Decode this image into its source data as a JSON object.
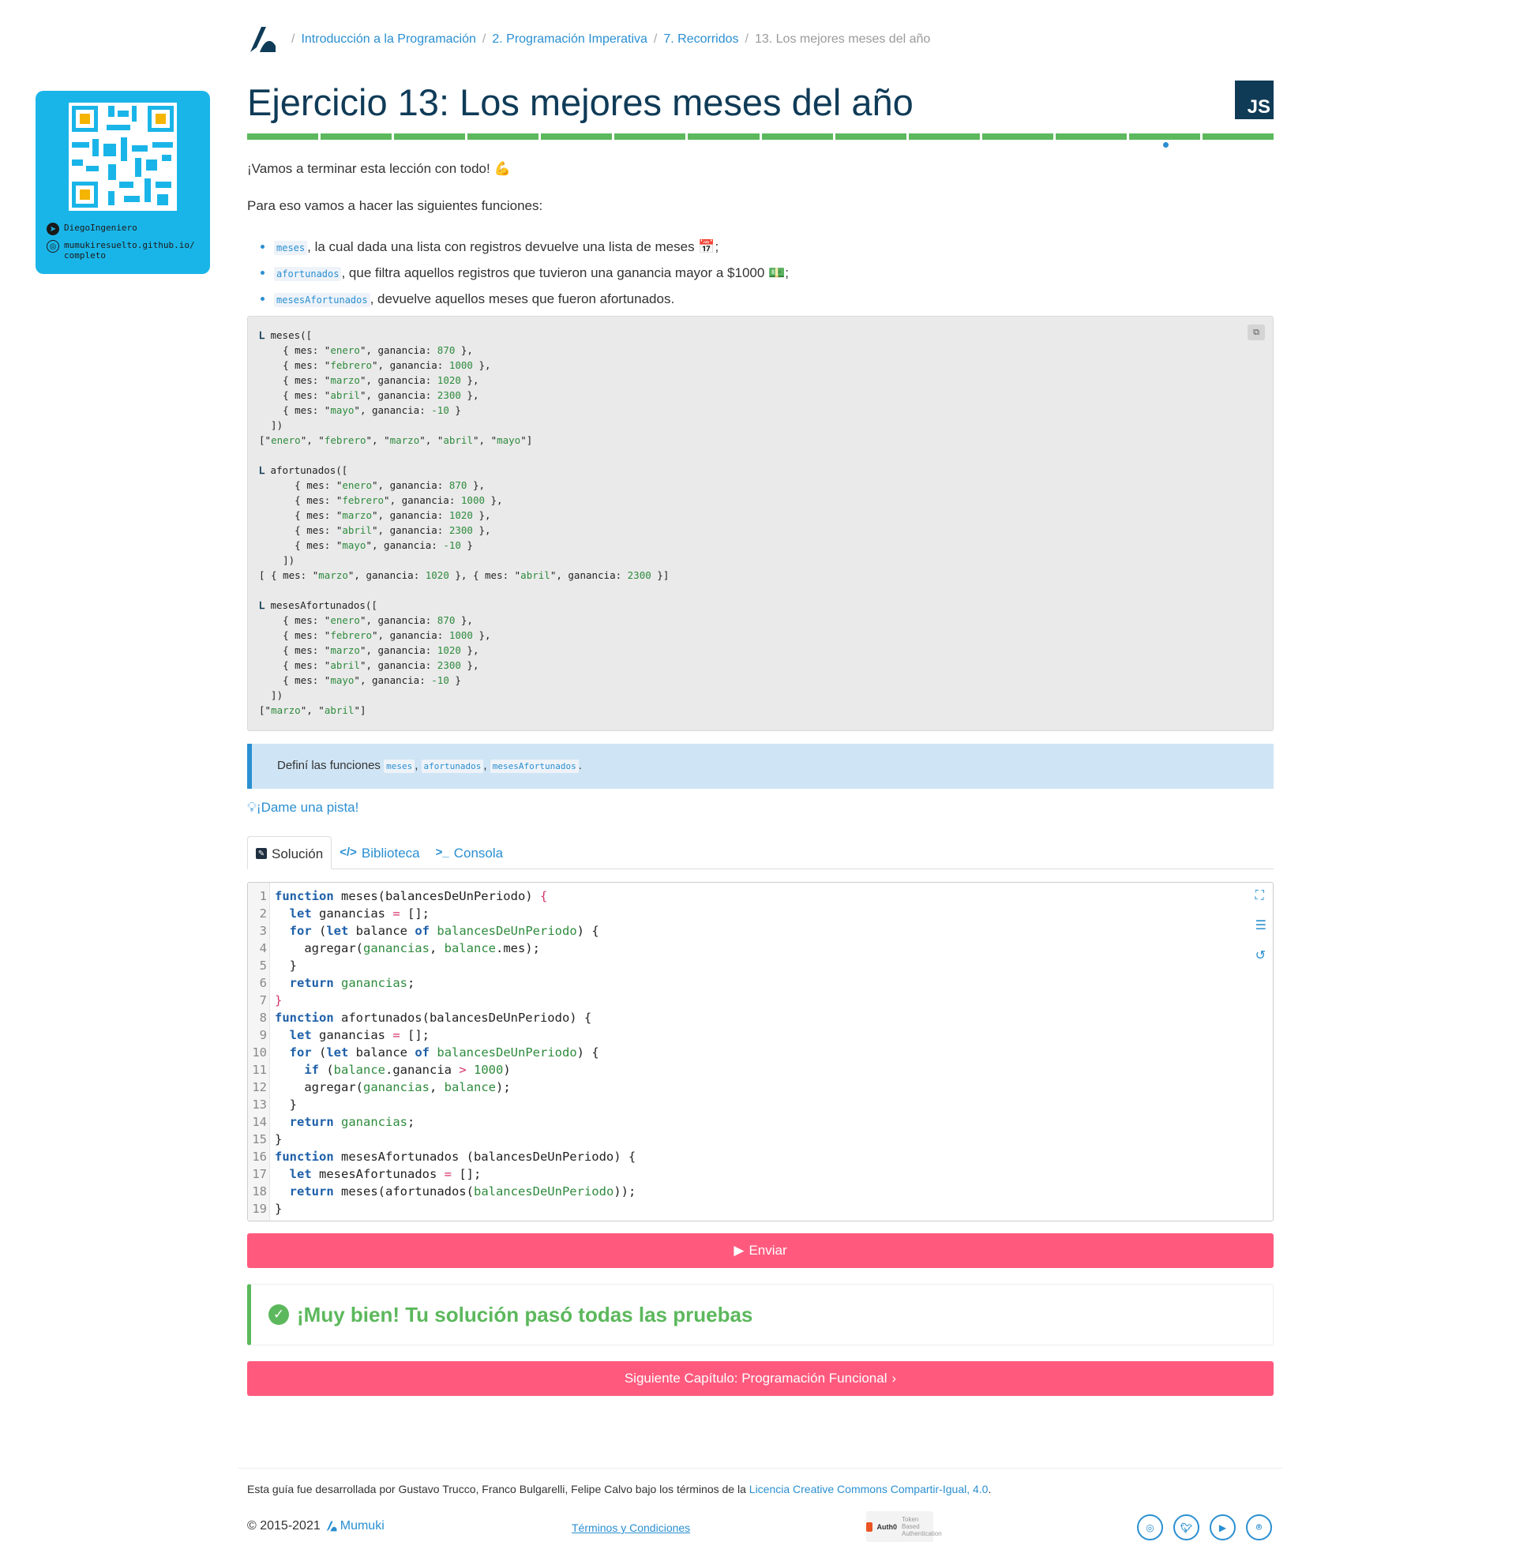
{
  "sidebar": {
    "telegram_user": "DiegoIngeniero",
    "website": "mumukiresuelto.github.io/completo",
    "website_line1": "mumukiresuelto.github.io/",
    "website_line2": "completo"
  },
  "breadcrumb": {
    "items": [
      "Introducción a la Programación",
      "2. Programación Imperativa",
      "7. Recorridos"
    ],
    "current": "13. Los mejores meses del año"
  },
  "exercise": {
    "title": "Ejercicio 13: Los mejores meses del año",
    "language_badge": "JS",
    "progress_segments": 14,
    "current_segment": 13,
    "intro": "¡Vamos a terminar esta lección con todo!",
    "intro_emoji": "💪",
    "intro2": "Para eso vamos a hacer las siguientes funciones:",
    "bullets": [
      {
        "code": "meses",
        "text": ", la cual dada una lista con registros devuelve una lista de meses",
        "emoji": "📅",
        "suffix": ";"
      },
      {
        "code": "afortunados",
        "text": ", que filtra aquellos registros que tuvieron una ganancia mayor a $1000",
        "emoji": "💵",
        "suffix": ";"
      },
      {
        "code": "mesesAfortunados",
        "text": ", devuelve aquellos meses que fueron afortunados.",
        "emoji": "",
        "suffix": ""
      }
    ]
  },
  "callout": {
    "prefix": "Definí las funciones",
    "codes": [
      "meses",
      "afortunados",
      "mesesAfortunados"
    ],
    "suffix": "."
  },
  "hint_label": "¡Dame una pista!",
  "tabs": [
    "Solución",
    "Biblioteca",
    "Consola"
  ],
  "submit_label": "Enviar",
  "result_message": "¡Muy bien! Tu solución pasó todas las pruebas",
  "next_chapter_label": "Siguiente Capítulo: Programación Funcional",
  "footer": {
    "credit_prefix": "Esta guía fue desarrollada por Gustavo Trucco, Franco Bulgarelli, Felipe Calvo bajo los términos de la",
    "license_link": "Licencia Creative Commons Compartir-Igual, 4.0",
    "credit_suffix": ".",
    "copyright": "© 2015-2021",
    "brand": "Mumuki",
    "terms": "Términos y Condiciones",
    "auth0_name": "Auth0",
    "auth0_tag": "Token Based Authentication",
    "socials": [
      "instagram-icon",
      "twitter-icon",
      "youtube-icon",
      "github-icon"
    ]
  },
  "colors": {
    "accent": "#2a8fd1",
    "primary_button": "#ff5a7e",
    "success": "#5cb85c",
    "title": "#0f3b57",
    "sidebar": "#1ab5e8"
  }
}
